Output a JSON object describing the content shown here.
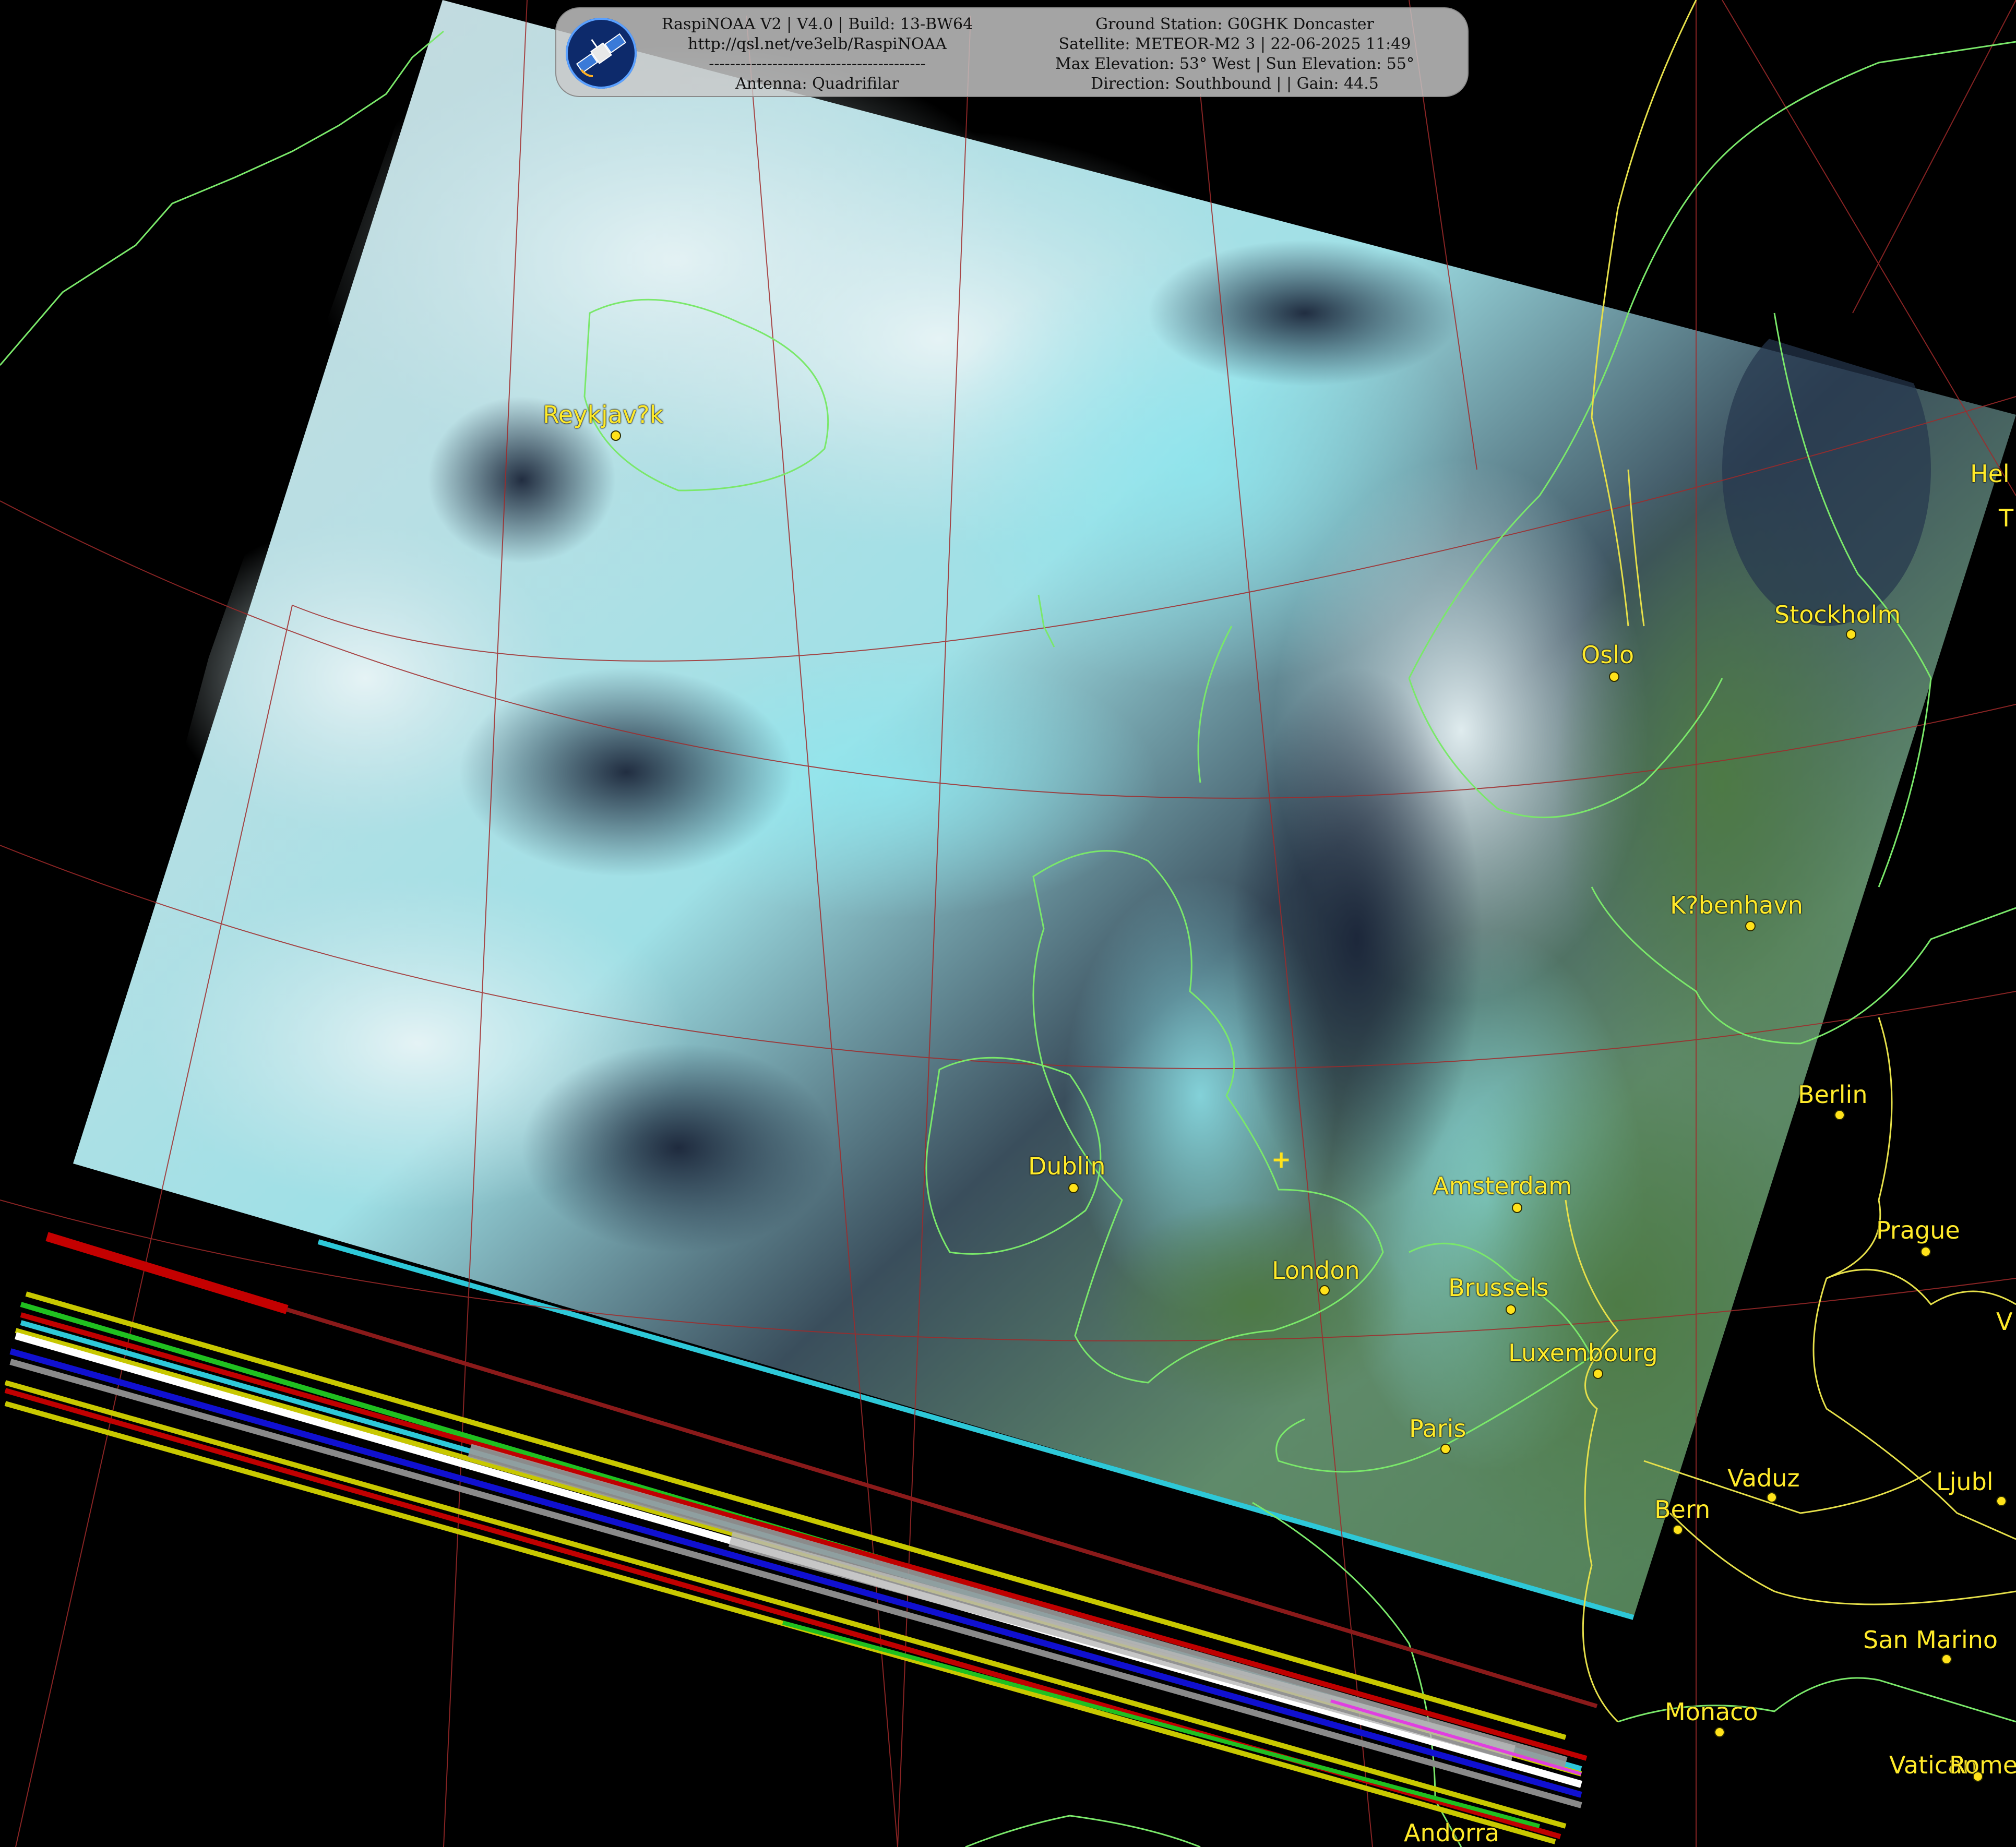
{
  "header": {
    "left_lines": [
      "RaspiNOAA V2 | V4.0 | Build: 13-BW64",
      "http://qsl.net/ve3elb/RaspiNOAA",
      "-----------------------------------------",
      "Antenna: Quadrifilar"
    ],
    "right_lines": [
      "Ground Station: G0GHK Doncaster",
      "Satellite: METEOR-M2 3 | 22-06-2025 11:49",
      "Max Elevation: 53° West | Sun Elevation: 55°",
      "Direction: Southbound | | Gain: 44.5"
    ],
    "logo_icon": "satellite-icon"
  },
  "colors": {
    "background": "#000000",
    "coastline": "#7ae86a",
    "borders": "#e6e04a",
    "graticule": "#a02a2a",
    "city_label": "#ffea2a",
    "panel": "#c8c8c8"
  },
  "cities": [
    {
      "name": "Reykjav?k"
    },
    {
      "name": "Oslo"
    },
    {
      "name": "Stockholm"
    },
    {
      "name": "Hel"
    },
    {
      "name": "T"
    },
    {
      "name": "K?benhavn"
    },
    {
      "name": "Berlin"
    },
    {
      "name": "Prague"
    },
    {
      "name": "V"
    },
    {
      "name": "Amsterdam"
    },
    {
      "name": "Dublin"
    },
    {
      "name": "London"
    },
    {
      "name": "Brussels"
    },
    {
      "name": "Luxembourg"
    },
    {
      "name": "Paris"
    },
    {
      "name": "Vaduz"
    },
    {
      "name": "Ljubl"
    },
    {
      "name": "Bern"
    },
    {
      "name": "San Marino"
    },
    {
      "name": "Monaco"
    },
    {
      "name": "Vatican"
    },
    {
      "name": "Rome"
    },
    {
      "name": "Andorra"
    }
  ]
}
